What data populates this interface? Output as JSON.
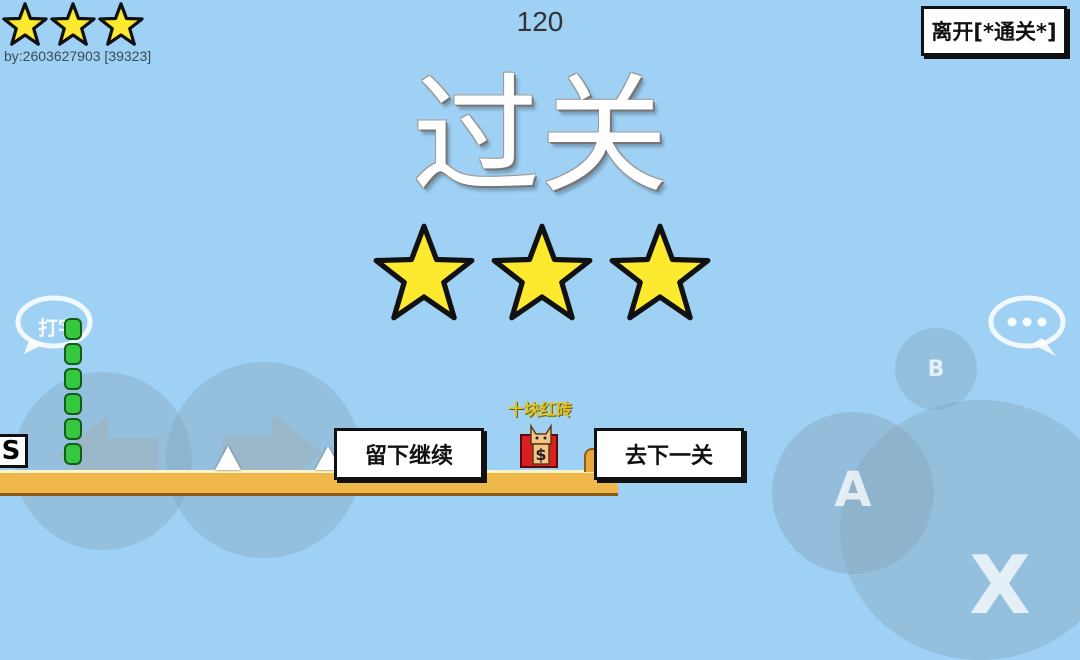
{
  "hud": {
    "stars_earned": 3,
    "author": "by:2603627903 [39323]",
    "score": "120",
    "leave_button": "离开[*通关*]"
  },
  "result": {
    "title": "过关",
    "stars": 3
  },
  "level": {
    "s_block": "S",
    "item_label": "十块红砖",
    "stay_button": "留下继续",
    "next_button": "去下一关"
  },
  "controls": {
    "chat_label": "打字",
    "b_label": "B",
    "a_label": "A",
    "x_label": "X",
    "chat_dots": "•••"
  },
  "colors": {
    "sky": "#9fd1f5",
    "star": "#fde92e",
    "ground": "#f0b84a",
    "item_label": "#e0c31f"
  }
}
